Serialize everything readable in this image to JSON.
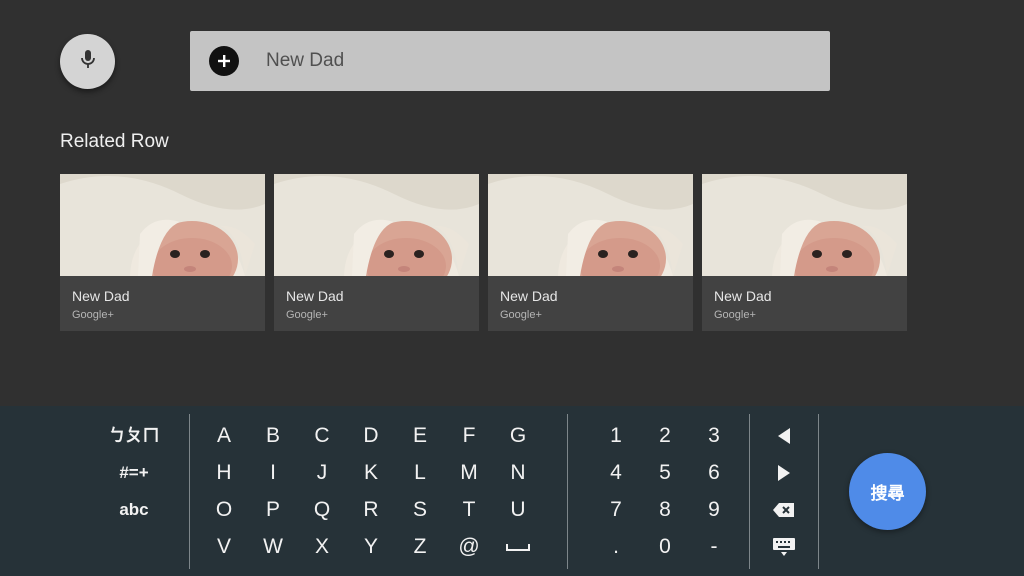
{
  "search": {
    "query": "New Dad",
    "mic_icon": "mic-icon",
    "add_icon": "plus-circle-icon"
  },
  "related": {
    "title": "Related Row",
    "cards": [
      {
        "title": "New Dad",
        "subtitle": "Google+"
      },
      {
        "title": "New Dad",
        "subtitle": "Google+"
      },
      {
        "title": "New Dad",
        "subtitle": "Google+"
      },
      {
        "title": "New Dad",
        "subtitle": "Google+"
      }
    ]
  },
  "keyboard": {
    "modes": [
      "ㄅㄆㄇ",
      "#=+",
      "abc"
    ],
    "letters": [
      [
        "A",
        "B",
        "C",
        "D",
        "E",
        "F",
        "G"
      ],
      [
        "H",
        "I",
        "J",
        "K",
        "L",
        "M",
        "N"
      ],
      [
        "O",
        "P",
        "Q",
        "R",
        "S",
        "T",
        "U"
      ],
      [
        "V",
        "W",
        "X",
        "Y",
        "Z",
        "@"
      ]
    ],
    "space_icon": "space-bar-icon",
    "numbers": [
      [
        "1",
        "2",
        "3"
      ],
      [
        "4",
        "5",
        "6"
      ],
      [
        "7",
        "8",
        "9"
      ],
      [
        ".",
        "0",
        "-"
      ]
    ],
    "nav_icons": [
      "arrow-left-icon",
      "arrow-right-icon",
      "backspace-icon",
      "keyboard-hide-icon"
    ],
    "search_label": "搜尋"
  },
  "colors": {
    "background": "#303030",
    "keyboard_bg": "#263238",
    "search_button": "#4f8be8",
    "card_bg": "#424242",
    "search_bar": "#c4c4c4"
  }
}
